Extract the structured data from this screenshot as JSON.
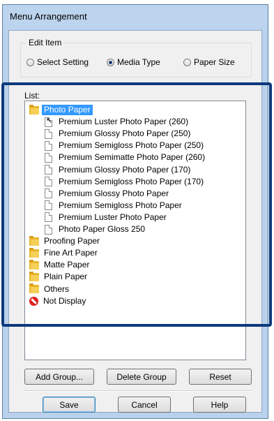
{
  "window": {
    "title": "Menu Arrangement"
  },
  "edit_item": {
    "legend": "Edit Item",
    "options": [
      {
        "label": "Select Setting",
        "checked": false
      },
      {
        "label": "Media Type",
        "checked": true
      },
      {
        "label": "Paper Size",
        "checked": false
      }
    ]
  },
  "list": {
    "label": "List:",
    "items": [
      {
        "label": "Photo Paper",
        "type": "folder",
        "selected": true
      },
      {
        "label": "Premium Luster Photo Paper (260)",
        "type": "document"
      },
      {
        "label": "Premium Glossy Photo Paper (250)",
        "type": "document"
      },
      {
        "label": "Premium Semigloss Photo Paper (250)",
        "type": "document"
      },
      {
        "label": "Premium Semimatte Photo Paper (260)",
        "type": "document"
      },
      {
        "label": "Premium Glossy Photo Paper (170)",
        "type": "document"
      },
      {
        "label": "Premium Semigloss Photo Paper (170)",
        "type": "document"
      },
      {
        "label": "Premium Glossy Photo Paper",
        "type": "document"
      },
      {
        "label": "Premium Semigloss Photo Paper",
        "type": "document"
      },
      {
        "label": "Premium Luster Photo Paper",
        "type": "document"
      },
      {
        "label": "Photo Paper Gloss 250",
        "type": "document"
      },
      {
        "label": "Proofing Paper",
        "type": "folder"
      },
      {
        "label": "Fine Art Paper",
        "type": "folder"
      },
      {
        "label": "Matte Paper",
        "type": "folder"
      },
      {
        "label": "Plain Paper",
        "type": "folder"
      },
      {
        "label": "Others",
        "type": "folder"
      },
      {
        "label": "Not Display",
        "type": "not-display"
      }
    ]
  },
  "buttons": {
    "add_group": "Add Group...",
    "delete_group": "Delete Group",
    "reset": "Reset",
    "save": "Save",
    "cancel": "Cancel",
    "help": "Help"
  },
  "colors": {
    "selection": "#3399ff",
    "highlight_frame": "#0d3a7c",
    "not_display_icon": "#e02020"
  }
}
